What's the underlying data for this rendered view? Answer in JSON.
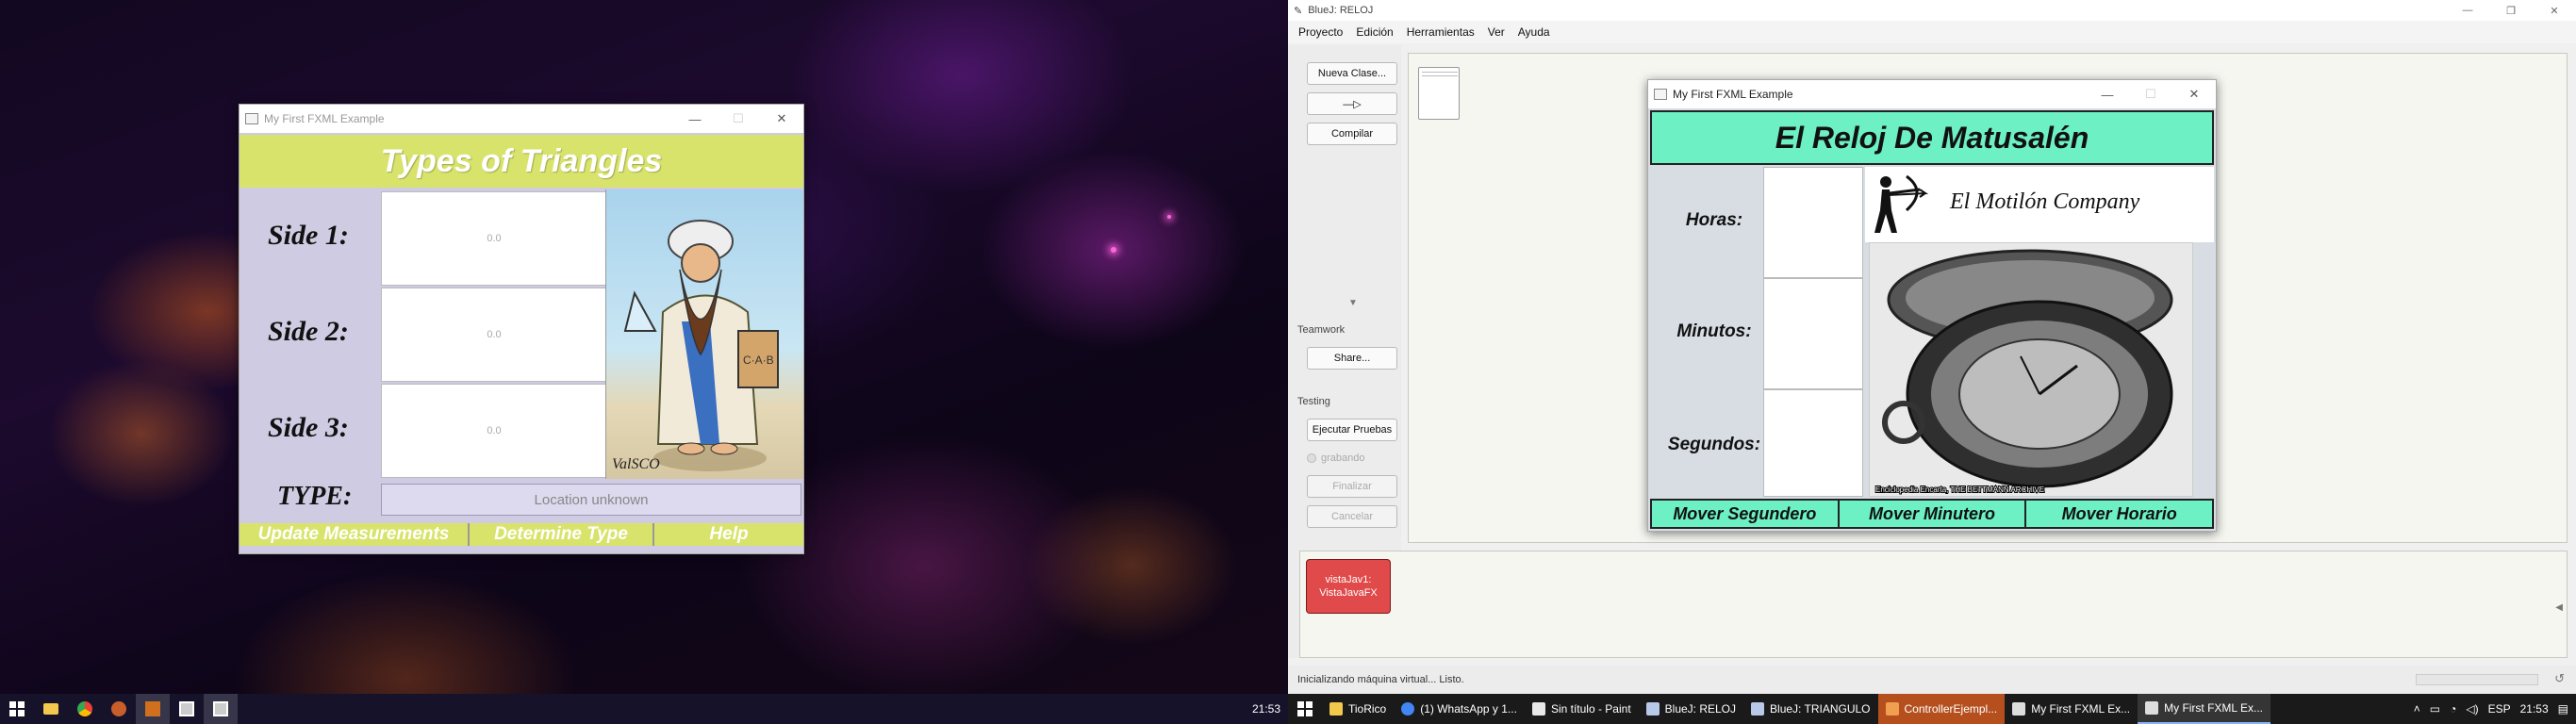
{
  "left": {
    "triangles_window": {
      "title": "My First FXML Example",
      "header": "Types of Triangles",
      "side1_label": "Side 1:",
      "side2_label": "Side 2:",
      "side3_label": "Side 3:",
      "side1_value": "0.0",
      "side2_value": "0.0",
      "side3_value": "0.0",
      "type_label": "TYPE:",
      "type_value": "Location unknown",
      "buttons": {
        "update": "Update Measurements",
        "determine": "Determine Type",
        "help": "Help"
      },
      "colors": {
        "accent": "#d8e36b",
        "background": "#cfcbe2"
      }
    },
    "taskbar": {
      "clock": "21:53"
    }
  },
  "right": {
    "bluej": {
      "title": "BlueJ: RELOJ",
      "menu": [
        "Proyecto",
        "Edición",
        "Herramientas",
        "Ver",
        "Ayuda"
      ],
      "buttons": {
        "new_class": "Nueva Clase...",
        "arrow": "—▷",
        "compile": "Compilar",
        "share": "Share...",
        "run_tests": "Ejecutar Pruebas",
        "finish": "Finalizar",
        "cancel": "Cancelar"
      },
      "sections": {
        "teamwork": "Teamwork",
        "testing": "Testing",
        "recording": "grabando"
      },
      "object_bench": {
        "object_label": "vistaJav1:\nVistaJavaFX"
      },
      "status": "Inicializando máquina virtual... Listo."
    },
    "reloj_window": {
      "title": "My First FXML Example",
      "header": "El Reloj De Matusalén",
      "labels": {
        "horas": "Horas:",
        "minutos": "Minutos:",
        "segundos": "Segundos:"
      },
      "brand": "El Motilón Company",
      "image_caption": "Enciclopedia Encarta, THE BETTMANN ARCHIVE",
      "buttons": {
        "seconds": "Mover Segundero",
        "minutes": "Mover Minutero",
        "hours": "Mover Horario"
      },
      "colors": {
        "accent": "#6cf0c4"
      }
    },
    "taskbar": {
      "apps": [
        "TioRico",
        "(1) WhatsApp y 1...",
        "Sin título - Paint",
        "BlueJ: RELOJ",
        "BlueJ: TRIANGULO",
        "ControllerEjempl...",
        "My First FXML Ex...",
        "My First FXML Ex..."
      ],
      "lang": "ESP",
      "clock": "21:53"
    }
  }
}
